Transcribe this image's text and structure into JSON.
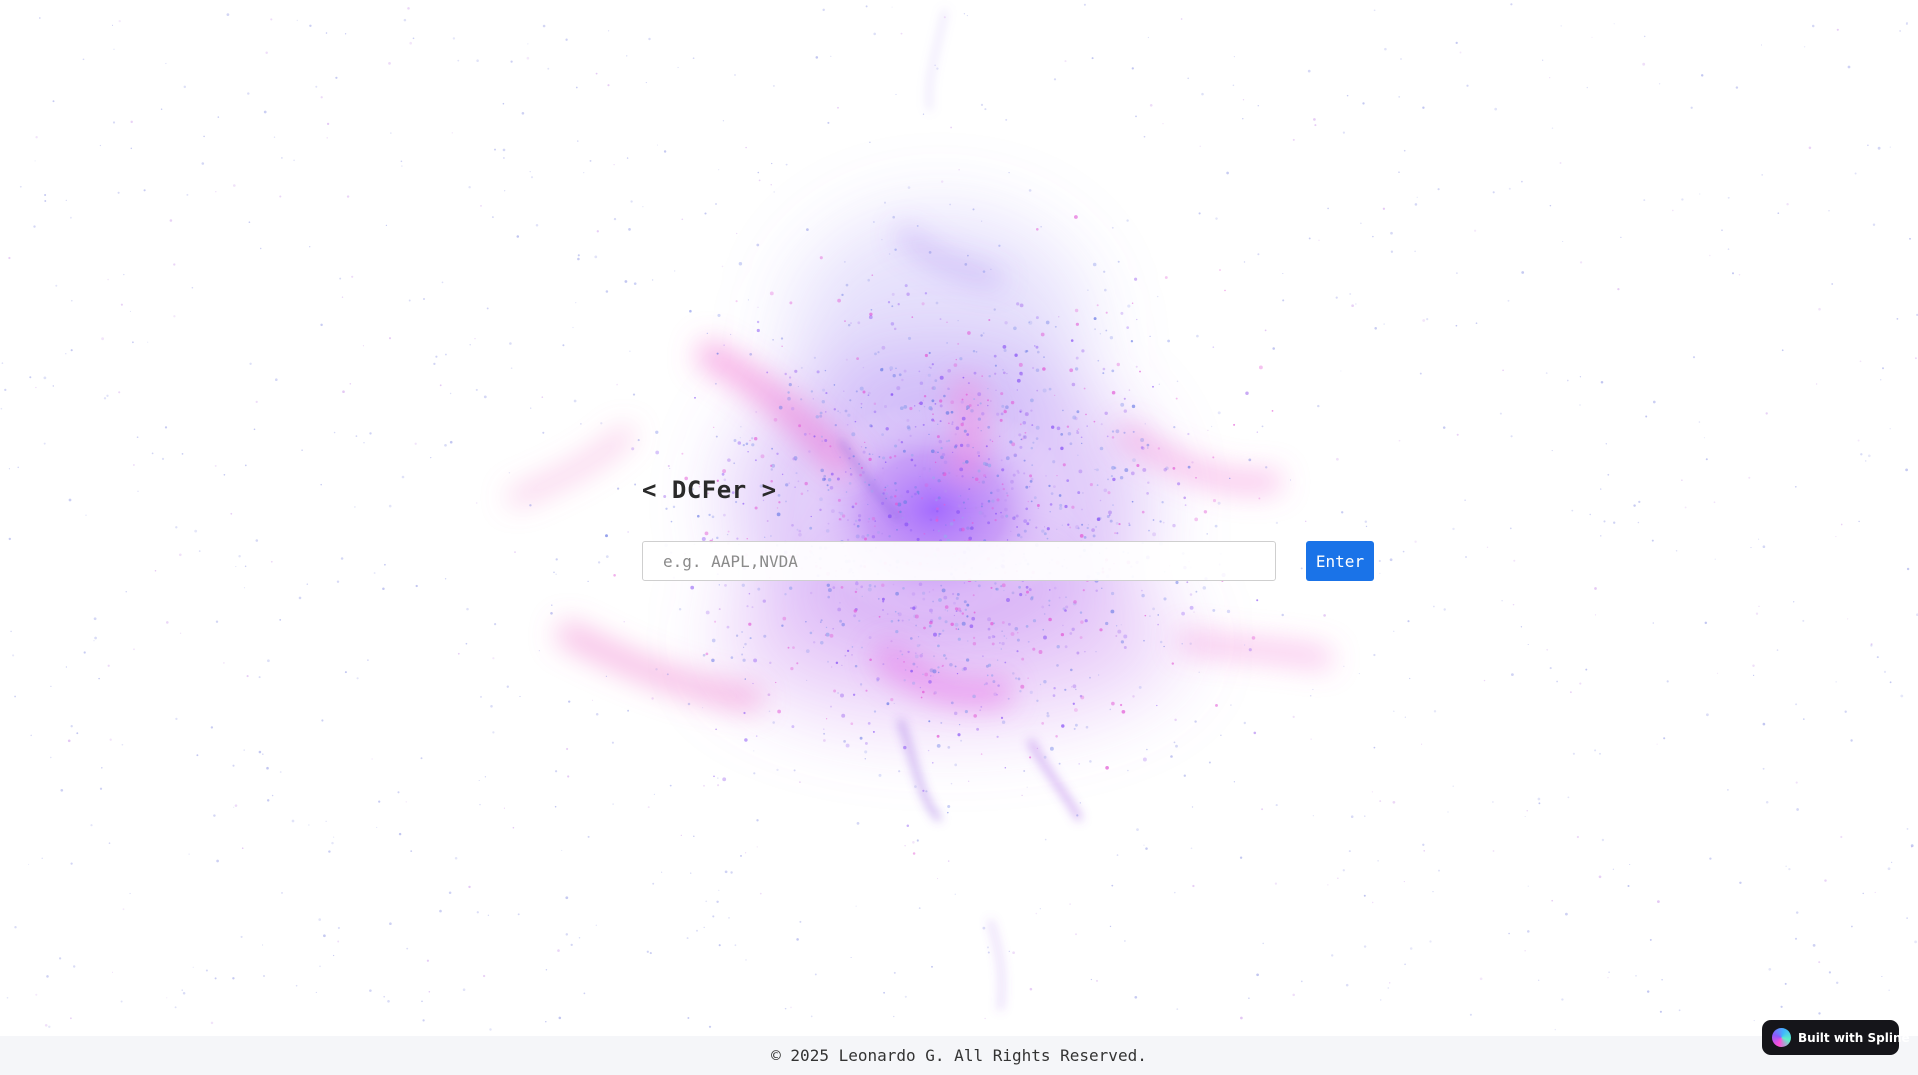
{
  "app": {
    "title": "< DCFer >"
  },
  "search": {
    "placeholder": "e.g. AAPL,NVDA",
    "value": ""
  },
  "actions": {
    "enter_label": "Enter"
  },
  "footer": {
    "text": "© 2025 Leonardo G. All Rights Reserved."
  },
  "badge": {
    "label": "Built with Spline",
    "icon": "spline-logo-icon"
  },
  "colors": {
    "accent": "#1a73e8",
    "particle_pink": "#e25ad6",
    "particle_purple": "#8a55f5",
    "particle_blue": "#6f7fe6",
    "badge_bg": "#15151a"
  }
}
